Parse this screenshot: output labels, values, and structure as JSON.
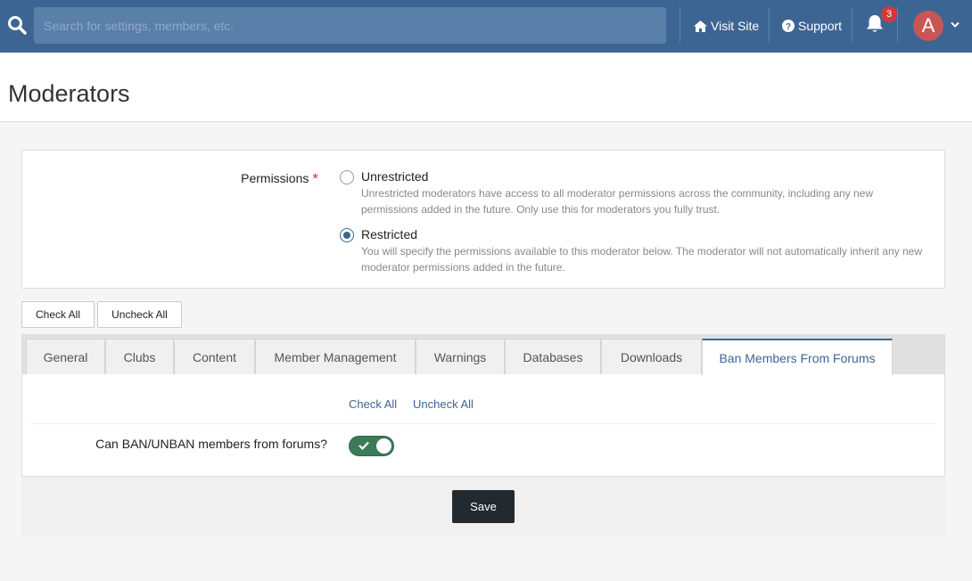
{
  "topbar": {
    "search_placeholder": "Search for settings, members, etc.",
    "visit_site": "Visit Site",
    "support": "Support",
    "notification_count": "3",
    "avatar_letter": "A"
  },
  "header": {
    "title": "Moderators"
  },
  "permissions": {
    "label": "Permissions",
    "required_mark": "*",
    "options": [
      {
        "title": "Unrestricted",
        "desc": "Unrestricted moderators have access to all moderator permissions across the community, including any new permissions added in the future. Only use this for moderators you fully trust.",
        "checked": false
      },
      {
        "title": "Restricted",
        "desc": "You will specify the permissions available to this moderator below. The moderator will not automatically inherit any new moderator permissions added in the future.",
        "checked": true
      }
    ]
  },
  "buttons": {
    "check_all": "Check All",
    "uncheck_all": "Uncheck All",
    "save": "Save"
  },
  "tabs": [
    {
      "label": "General"
    },
    {
      "label": "Clubs"
    },
    {
      "label": "Content"
    },
    {
      "label": "Member Management"
    },
    {
      "label": "Warnings"
    },
    {
      "label": "Databases"
    },
    {
      "label": "Downloads"
    },
    {
      "label": "Ban Members From Forums",
      "active": true
    }
  ],
  "tab_content": {
    "check_all": "Check All",
    "uncheck_all": "Uncheck All",
    "setting_label": "Can BAN/UNBAN members from forums?",
    "setting_enabled": true
  },
  "colors": {
    "brand": "#3d6594",
    "toggle_on": "#3c7a58",
    "badge": "#d4393a"
  }
}
